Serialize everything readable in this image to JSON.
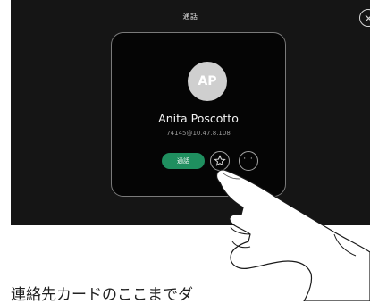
{
  "header": {
    "title": "通話"
  },
  "contact": {
    "initials": "AP",
    "name": "Anita Poscotto",
    "address": "74145@10.47.8.108"
  },
  "actions": {
    "call_label": "通話",
    "more_label": "···"
  },
  "icons": {
    "close": "close-icon",
    "favorite": "star-icon",
    "more": "more-icon"
  },
  "colors": {
    "screen_bg": "#151515",
    "card_bg": "#050505",
    "avatar_bg": "#cfcfcf",
    "call_button": "#1f8f5f"
  },
  "caption": {
    "text": "連絡先カードのここまでダ"
  }
}
